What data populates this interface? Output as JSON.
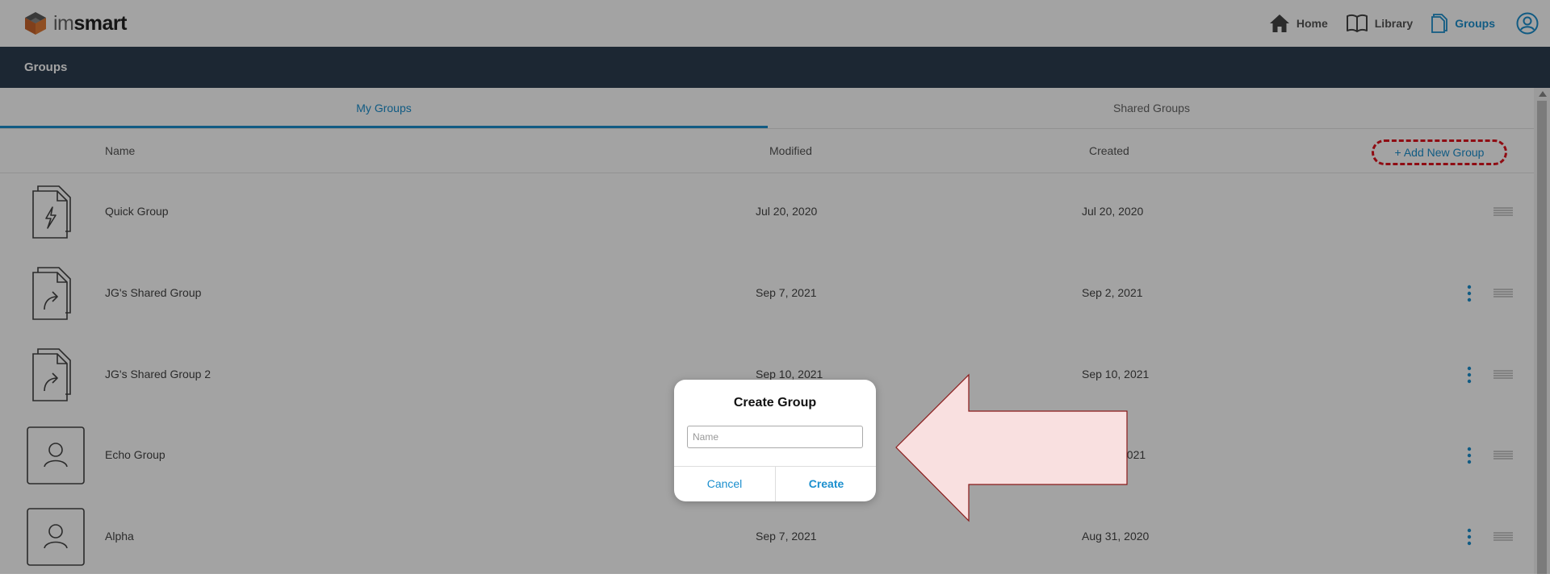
{
  "app": {
    "logo_prefix": "im",
    "logo_suffix": "smart"
  },
  "nav": {
    "home": "Home",
    "library": "Library",
    "groups": "Groups"
  },
  "subheader": {
    "title": "Groups"
  },
  "tabs": [
    {
      "label": "My Groups",
      "active": true
    },
    {
      "label": "Shared Groups",
      "active": false
    }
  ],
  "table": {
    "columns": {
      "name": "Name",
      "modified": "Modified",
      "created": "Created"
    },
    "add_label": "+ Add New Group",
    "rows": [
      {
        "name": "Quick Group",
        "modified": "Jul 20, 2020",
        "created": "Jul 20, 2020",
        "icon": "quick-group-icon",
        "has_menu": false
      },
      {
        "name": "JG's Shared Group",
        "modified": "Sep 7, 2021",
        "created": "Sep 2, 2021",
        "icon": "shared-group-icon",
        "has_menu": true
      },
      {
        "name": "JG's Shared Group 2",
        "modified": "Sep 10, 2021",
        "created": "Sep 10, 2021",
        "icon": "shared-group-icon",
        "has_menu": true
      },
      {
        "name": "Echo Group",
        "modified": "",
        "created": "2021",
        "icon": "person-icon",
        "has_menu": true
      },
      {
        "name": "Alpha",
        "modified": "Sep 7, 2021",
        "created": "Aug 31, 2020",
        "icon": "person-icon",
        "has_menu": true
      }
    ]
  },
  "dialog": {
    "title": "Create Group",
    "name_placeholder": "Name",
    "name_value": "",
    "cancel": "Cancel",
    "create": "Create"
  },
  "colors": {
    "accent": "#1b8fce",
    "header_dark": "#2c3e50",
    "highlight_red": "#e0141e",
    "arrow_fill": "#f9e0e0",
    "arrow_stroke": "#8b1a1a"
  }
}
